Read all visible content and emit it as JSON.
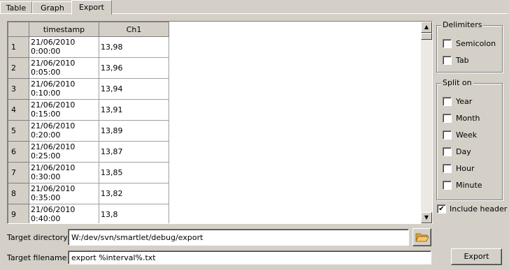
{
  "tabs": [
    {
      "label": "Table"
    },
    {
      "label": "Graph"
    },
    {
      "label": "Export"
    }
  ],
  "grid": {
    "columns": [
      "timestamp",
      "Ch1"
    ],
    "rows": [
      {
        "n": "1",
        "date": "21/06/2010",
        "time": "0:00:00",
        "ch1": "13,98"
      },
      {
        "n": "2",
        "date": "21/06/2010",
        "time": "0:05:00",
        "ch1": "13,96"
      },
      {
        "n": "3",
        "date": "21/06/2010",
        "time": "0:10:00",
        "ch1": "13,94"
      },
      {
        "n": "4",
        "date": "21/06/2010",
        "time": "0:15:00",
        "ch1": "13,91"
      },
      {
        "n": "5",
        "date": "21/06/2010",
        "time": "0:20:00",
        "ch1": "13,89"
      },
      {
        "n": "6",
        "date": "21/06/2010",
        "time": "0:25:00",
        "ch1": "13,87"
      },
      {
        "n": "7",
        "date": "21/06/2010",
        "time": "0:30:00",
        "ch1": "13,85"
      },
      {
        "n": "8",
        "date": "21/06/2010",
        "time": "0:35:00",
        "ch1": "13,82"
      },
      {
        "n": "9",
        "date": "21/06/2010",
        "time": "0:40:00",
        "ch1": "13,8"
      }
    ]
  },
  "delimiters": {
    "title": "Delimiters",
    "options": [
      {
        "label": "Semicolon",
        "checked": false
      },
      {
        "label": "Tab",
        "checked": false
      }
    ]
  },
  "split": {
    "title": "Split on",
    "options": [
      {
        "label": "Year",
        "checked": false
      },
      {
        "label": "Month",
        "checked": false
      },
      {
        "label": "Week",
        "checked": false
      },
      {
        "label": "Day",
        "checked": false
      },
      {
        "label": "Hour",
        "checked": false
      },
      {
        "label": "Minute",
        "checked": false
      }
    ]
  },
  "include_header": {
    "label": "Include header",
    "checked": true
  },
  "target_directory": {
    "label": "Target directory:",
    "value": "W:/dev/svn/smartlet/debug/export"
  },
  "target_filename": {
    "label": "Target filename:",
    "value": "export %interval%.txt"
  },
  "export_button": {
    "label": "Export"
  },
  "icons": {
    "folder": "folder-open-icon",
    "scroll_up": "arrow-up-icon",
    "scroll_down": "arrow-down-icon",
    "check": "checkmark-icon"
  }
}
